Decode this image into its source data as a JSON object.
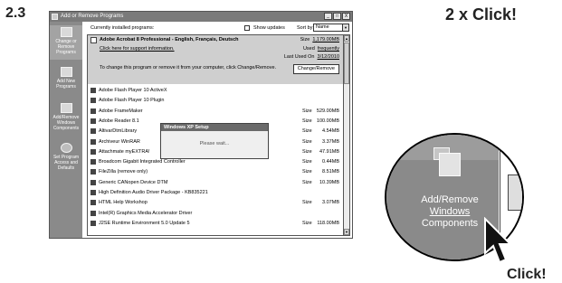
{
  "step_number": "2.3",
  "instruction": "2 x Click!",
  "pointer_label": "Click!",
  "window": {
    "title": "Add or Remove Programs",
    "buttons": [
      "_",
      "□",
      "X"
    ]
  },
  "sidebar": {
    "items": [
      {
        "label": "Change or Remove Programs",
        "icon": "change-remove-icon"
      },
      {
        "label": "Add New Programs",
        "icon": "add-programs-icon"
      },
      {
        "label": "Add/Remove Windows Components",
        "icon": "windows-components-icon"
      },
      {
        "label": "Set Program Access and Defaults",
        "icon": "program-access-icon"
      }
    ]
  },
  "topbar": {
    "installed_label": "Currently installed programs:",
    "show_updates_label": "Show updates",
    "sort_by_label": "Sort by:",
    "sort_value": "Name"
  },
  "selected": {
    "name": "Adobe Acrobat 8 Professional - English, Français, Deutsch",
    "support_link": "Click here for support information.",
    "instruction": "To change this program or remove it from your computer, click Change/Remove.",
    "size_label": "Size",
    "size_value": "1,179.00MB",
    "used_label": "Used",
    "used_value": "frequently",
    "last_used_label": "Last Used On",
    "last_used_value": "3/12/2010",
    "button_label": "Change/Remove"
  },
  "programs": [
    {
      "name": "Adobe Flash Player 10 ActiveX",
      "size": ""
    },
    {
      "name": "Adobe Flash Player 10 Plugin",
      "size": ""
    },
    {
      "name": "Adobe FrameMaker",
      "size": "529.00MB"
    },
    {
      "name": "Adobe Reader 8.1",
      "size": "100.00MB"
    },
    {
      "name": "AltivarDtmLibrary",
      "size": "4.54MB"
    },
    {
      "name": "Archiveur WinRAR",
      "size": "3.37MB"
    },
    {
      "name": "Attachmate myEXTRA!",
      "size": "47.91MB"
    },
    {
      "name": "Broadcom Gigabit Integrated Controller",
      "size": "0.44MB"
    },
    {
      "name": "FileZilla (remove only)",
      "size": "8.51MB"
    },
    {
      "name": "Generic CANopen Device DTM",
      "size": "10.39MB"
    },
    {
      "name": "High Definition Audio Driver Package - KB835221",
      "size": ""
    },
    {
      "name": "HTML Help Workshop",
      "size": "3.07MB"
    },
    {
      "name": "Intel(R) Graphics Media Accelerator Driver",
      "size": ""
    },
    {
      "name": "J2SE Runtime Environment 5.0 Update 5",
      "size": "118.00MB"
    }
  ],
  "size_label": "Size",
  "dialog": {
    "title": "Windows XP Setup",
    "message": "Please wait..."
  },
  "zoom": {
    "label_line1": "Add/Remove",
    "label_line2": "Windows",
    "label_line3": "Components"
  }
}
